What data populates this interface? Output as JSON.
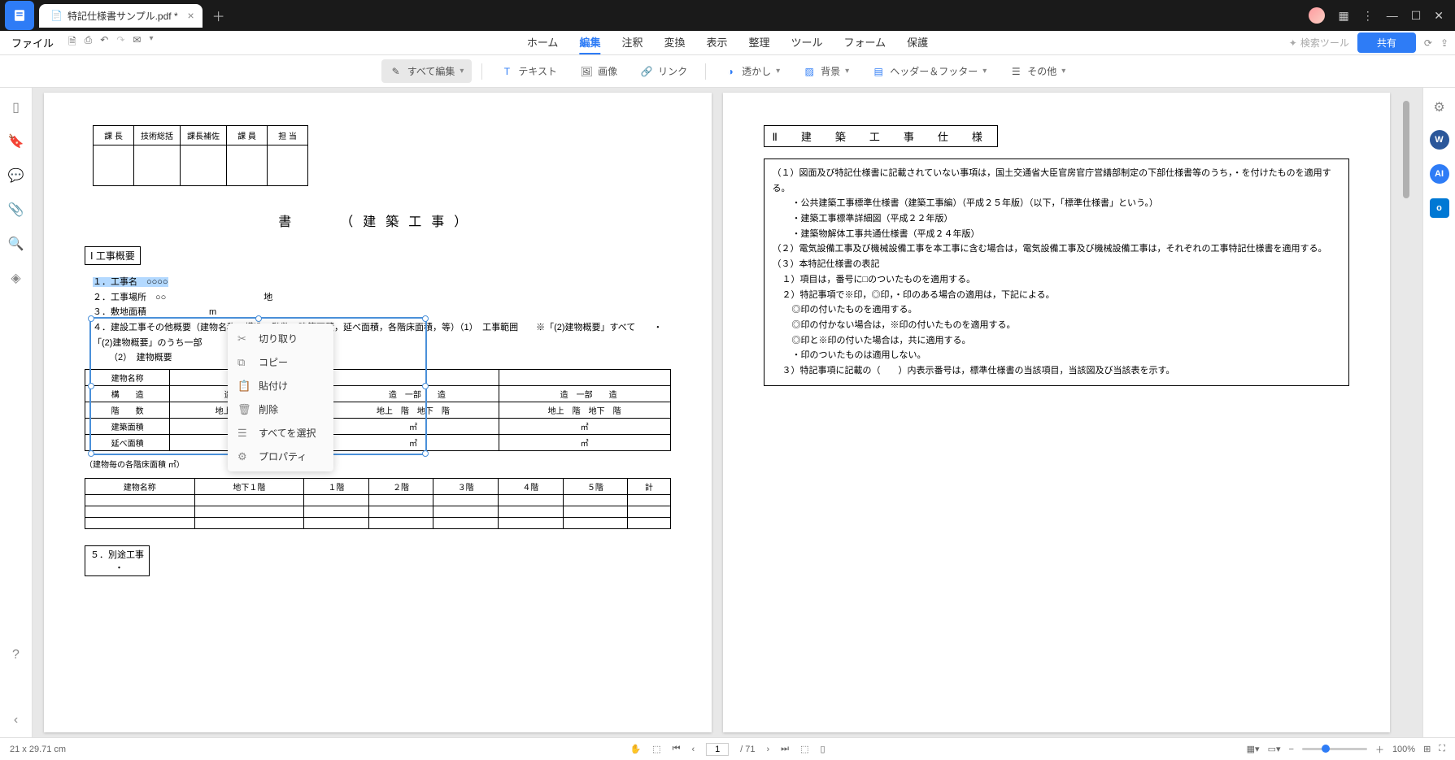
{
  "tab": {
    "title": "特記仕様書サンプル.pdf *"
  },
  "menubar": {
    "file": "ファイル",
    "tabs": {
      "home": "ホーム",
      "edit": "編集",
      "comment": "注釈",
      "convert": "変換",
      "view": "表示",
      "organize": "整理",
      "tool": "ツール",
      "form": "フォーム",
      "protect": "保護"
    },
    "search_tool": "検索ツール",
    "share": "共有"
  },
  "toolbar": {
    "edit_all": "すべて編集",
    "text": "テキスト",
    "image": "画像",
    "link": "リンク",
    "watermark": "透かし",
    "background": "背景",
    "header_footer": "ヘッダー＆フッター",
    "other": "その他"
  },
  "context_menu": {
    "cut": "切り取り",
    "copy": "コピー",
    "paste": "貼付け",
    "delete": "削除",
    "select_all": "すべてを選択",
    "properties": "プロパティ"
  },
  "page1": {
    "approval_headers": [
      "課 長",
      "技術総括",
      "課長補佐",
      "課 員",
      "担 当"
    ],
    "title_suffix": "書　　（建築工事）",
    "sec1": "Ⅰ 工事概要",
    "items": {
      "1": "１．工事名　○○○○",
      "2": "２．工事場所　○○",
      "2_suffix": "地",
      "3": "３．敷地面積　　　　　　　m",
      "4": "４．建設工事その他概要（建物名称，構造，階数，建築面積，延べ面積，各階床面積，等）（1）　工事範囲　　※「(2)建物概要」すべて　　・「(2)建物概要」のうち一部",
      "4b": "（2）　建物概要",
      "5": "５．別途工事",
      "5b": "・"
    },
    "bldg": {
      "rows": [
        "建物名称",
        "構　　造",
        "階　　数",
        "建築面積",
        "延べ面積"
      ],
      "r2": [
        "　造　一部　　造",
        "　造　一部　　造",
        "　造　一部　　造"
      ],
      "r3": [
        "地上○階　地下○階",
        "地上　階　地下　階",
        "地上　階　地下　階"
      ],
      "r4": [
        "㎡",
        "㎡",
        "㎡"
      ],
      "r5": [
        "㎡",
        "㎡",
        "㎡"
      ]
    },
    "floor_caption": "（建物毎の各階床面積 ㎡）",
    "floor_hdrs": [
      "建物名称",
      "地下１階",
      "１階",
      "２階",
      "３階",
      "４階",
      "５階",
      "計"
    ]
  },
  "page2": {
    "sec_title": "Ⅱ　建　築　工　事　仕　様",
    "p1": "（１）図面及び特記仕様書に記載されていない事項は，国土交通省大臣官房官庁営繕部制定の下部仕様書等のうち，・を付けたものを適用する。",
    "p1a": "・公共建築工事標準仕様書（建築工事編）（平成２５年版）（以下，「標準仕様書」という。）",
    "p1b": "・建築工事標準詳細図（平成２２年版）",
    "p1c": "・建築物解体工事共通仕様書（平成２４年版）",
    "p2": "（２）電気設備工事及び機械設備工事を本工事に含む場合は，電気設備工事及び機械設備工事は，それぞれの工事特記仕様書を適用する。",
    "p3": "（３）本特記仕様書の表記",
    "p3a": "１）項目は，番号に□のついたものを適用する。",
    "p3b": "２）特記事項で※印，◎印，・印のある場合の適用は，下記による。",
    "p3c": "◎印の付いたものを適用する。",
    "p3d": "◎印の付かない場合は，※印の付いたものを適用する。",
    "p3e": "◎印と※印の付いた場合は，共に適用する。",
    "p3f": "・印のついたものは適用しない。",
    "p3g": "３）特記事項に記載の（　　）内表示番号は，標準仕様書の当該項目，当該図及び当該表を示す。"
  },
  "status": {
    "dimensions": "21 x 29.71 cm",
    "page_current": "1",
    "page_total": "/ 71",
    "zoom": "100%"
  }
}
